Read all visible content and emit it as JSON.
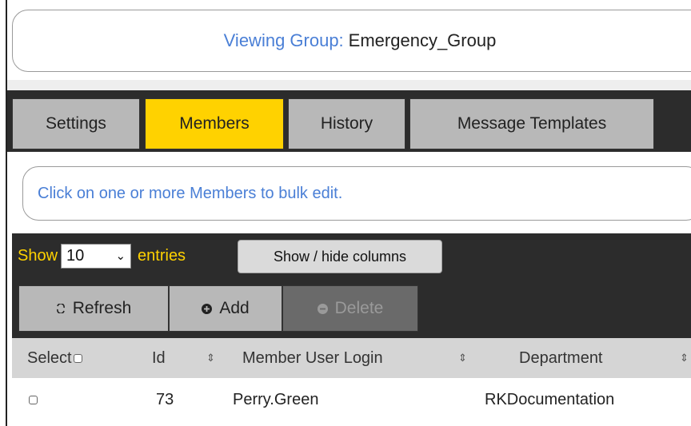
{
  "header": {
    "label": "Viewing Group:",
    "group_name": "Emergency_Group"
  },
  "tabs": [
    {
      "label": "Settings",
      "active": false
    },
    {
      "label": "Members",
      "active": true
    },
    {
      "label": "History",
      "active": false
    },
    {
      "label": "Message Templates",
      "active": false
    }
  ],
  "info_message": "Click on one or more Members to bulk edit.",
  "length_control": {
    "prefix": "Show",
    "value": "10",
    "suffix": "entries"
  },
  "buttons": {
    "column_visibility": "Show / hide columns",
    "refresh": "Refresh",
    "add": "Add",
    "delete": "Delete"
  },
  "table": {
    "columns": [
      "Select",
      "Id",
      "Member User Login",
      "Department"
    ],
    "rows": [
      {
        "id": "73",
        "login": "Perry.Green",
        "department": "RKDocumentation"
      }
    ]
  },
  "colors": {
    "accent": "#ffd200",
    "link": "#4a7fd6",
    "dark_bar": "#2c2c2c"
  }
}
